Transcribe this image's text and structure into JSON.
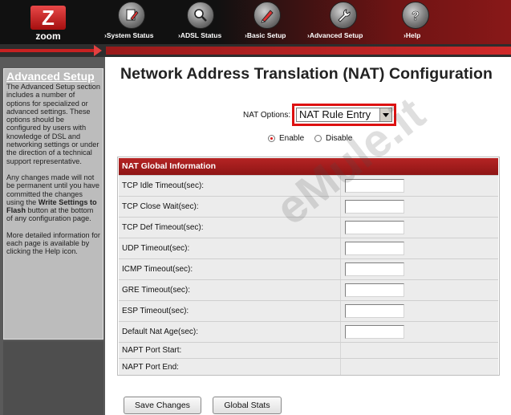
{
  "brand": {
    "logo_letter": "Z",
    "logo_text": "zoom"
  },
  "nav": {
    "items": [
      {
        "label": "System Status",
        "icon": "document-pencil-icon"
      },
      {
        "label": "ADSL Status",
        "icon": "magnifier-icon"
      },
      {
        "label": "Basic Setup",
        "icon": "pen-icon"
      },
      {
        "label": "Advanced Setup",
        "icon": "wrench-icon"
      },
      {
        "label": "Help",
        "icon": "question-icon"
      }
    ]
  },
  "sidebar": {
    "title": "Advanced Setup",
    "para1": "The Advanced Setup section includes a number of options for specialized or advanced settings. These options should be configured by users with knowledge of DSL and networking settings or under the direction of a technical support representative.",
    "para2_pre": "Any changes made will not be permanent until you have committed the changes using the ",
    "para2_bold": "Write Settings to Flash",
    "para2_post": " button at the bottom of any configuration page.",
    "para3": "More detailed information for each page is available by clicking the Help icon."
  },
  "page": {
    "title": "Network Address Translation (NAT) Configuration",
    "nat_options_label": "NAT Options:",
    "nat_options_value": "NAT Rule Entry",
    "radio_enable": "Enable",
    "radio_disable": "Disable",
    "enabled": true
  },
  "table": {
    "header": "NAT Global Information",
    "rows": [
      {
        "label": "TCP Idle Timeout(sec):",
        "value": ""
      },
      {
        "label": "TCP Close Wait(sec):",
        "value": ""
      },
      {
        "label": "TCP Def Timeout(sec):",
        "value": ""
      },
      {
        "label": "UDP Timeout(sec):",
        "value": ""
      },
      {
        "label": "ICMP Timeout(sec):",
        "value": ""
      },
      {
        "label": "GRE Timeout(sec):",
        "value": ""
      },
      {
        "label": "ESP Timeout(sec):",
        "value": ""
      },
      {
        "label": "Default Nat Age(sec):",
        "value": ""
      },
      {
        "label": "NAPT Port Start:",
        "value": ""
      },
      {
        "label": "NAPT Port End:",
        "value": ""
      }
    ]
  },
  "buttons": {
    "save": "Save Changes",
    "global_stats": "Global Stats"
  },
  "watermark": "eMule.it",
  "colors": {
    "accent_red": "#c82121",
    "header_red": "#8e1515",
    "sidebar_gray": "#5a5a5a"
  }
}
